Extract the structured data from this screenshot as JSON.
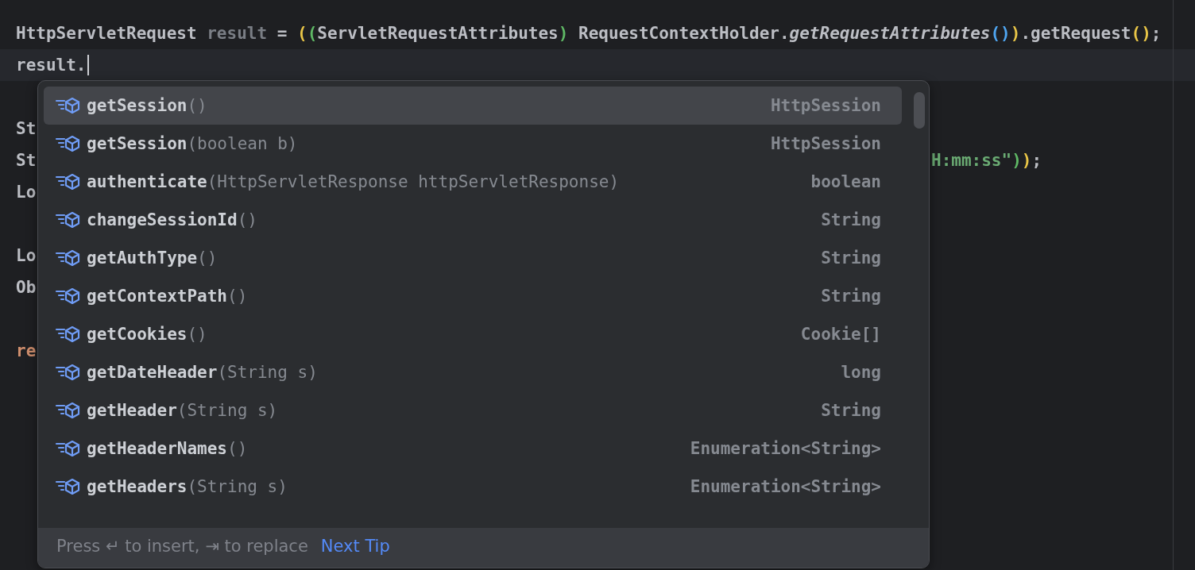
{
  "editor": {
    "lines": [
      {
        "caret": false,
        "tokens": [
          {
            "text": "HttpServletRequest ",
            "kind": "plain"
          },
          {
            "text": "result",
            "kind": "unused"
          },
          {
            "text": " = ",
            "kind": "plain"
          },
          {
            "text": "(",
            "kind": "bracket_gold"
          },
          {
            "text": "(",
            "kind": "bracket_green"
          },
          {
            "text": "ServletRequestAttributes",
            "kind": "plain"
          },
          {
            "text": ")",
            "kind": "bracket_green"
          },
          {
            "text": " RequestContextHolder.",
            "kind": "plain"
          },
          {
            "text": "getRequestAttributes",
            "kind": "static_call"
          },
          {
            "text": "()",
            "kind": "bracket_blue"
          },
          {
            "text": ")",
            "kind": "bracket_gold"
          },
          {
            "text": ".getRequest",
            "kind": "plain"
          },
          {
            "text": "()",
            "kind": "bracket_gold"
          },
          {
            "text": ";",
            "kind": "plain"
          }
        ]
      },
      {
        "caret": true,
        "tokens": [
          {
            "text": "result.",
            "kind": "plain"
          }
        ]
      },
      {
        "caret": false
      },
      {
        "caret": false,
        "tokens": [
          {
            "text": "St",
            "kind": "plain"
          }
        ]
      },
      {
        "caret": false,
        "tokens": [
          {
            "text": "St",
            "kind": "plain"
          }
        ],
        "tail": [
          {
            "text": "H:mm:ss\"",
            "kind": "string"
          },
          {
            "text": ")",
            "kind": "bracket_green"
          },
          {
            "text": ")",
            "kind": "bracket_gold"
          },
          {
            "text": ";",
            "kind": "plain"
          }
        ]
      },
      {
        "caret": false,
        "tokens": [
          {
            "text": "Lo",
            "kind": "plain"
          }
        ]
      },
      {
        "caret": false
      },
      {
        "caret": false,
        "tokens": [
          {
            "text": "Lo",
            "kind": "plain"
          }
        ]
      },
      {
        "caret": false,
        "tokens": [
          {
            "text": "Ob",
            "kind": "plain"
          }
        ]
      },
      {
        "caret": false
      },
      {
        "caret": false,
        "tokens": [
          {
            "text": "re",
            "kind": "keyword"
          }
        ]
      }
    ]
  },
  "completion": {
    "items": [
      {
        "name": "getSession",
        "params": "()",
        "type": "HttpSession",
        "selected": true
      },
      {
        "name": "getSession",
        "params": "(boolean b)",
        "type": "HttpSession",
        "selected": false
      },
      {
        "name": "authenticate",
        "params": "(HttpServletResponse httpServletResponse)",
        "type": "boolean",
        "selected": false
      },
      {
        "name": "changeSessionId",
        "params": "()",
        "type": "String",
        "selected": false
      },
      {
        "name": "getAuthType",
        "params": "()",
        "type": "String",
        "selected": false
      },
      {
        "name": "getContextPath",
        "params": "()",
        "type": "String",
        "selected": false
      },
      {
        "name": "getCookies",
        "params": "()",
        "type": "Cookie[]",
        "selected": false
      },
      {
        "name": "getDateHeader",
        "params": "(String s)",
        "type": "long",
        "selected": false
      },
      {
        "name": "getHeader",
        "params": "(String s)",
        "type": "String",
        "selected": false
      },
      {
        "name": "getHeaderNames",
        "params": "()",
        "type": "Enumeration<String>",
        "selected": false
      },
      {
        "name": "getHeaders",
        "params": "(String s)",
        "type": "Enumeration<String>",
        "selected": false
      }
    ],
    "footer": {
      "hint": "Press ↵ to insert, ⇥ to replace",
      "link": "Next Tip"
    }
  }
}
